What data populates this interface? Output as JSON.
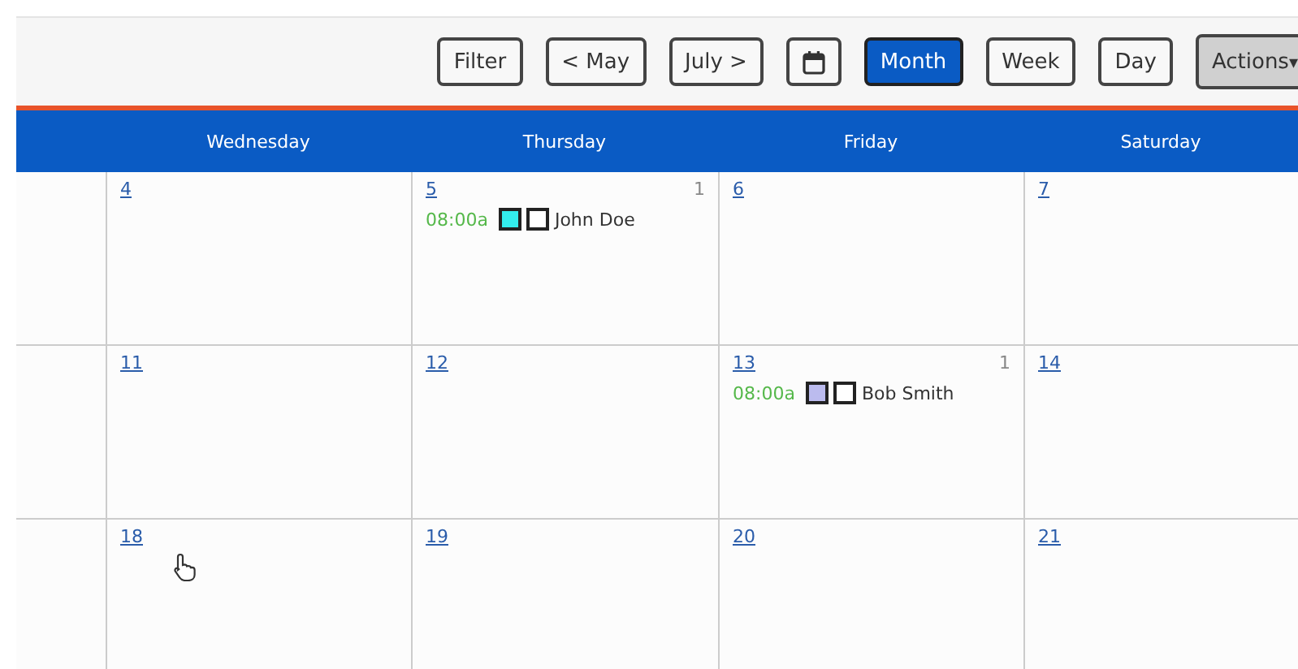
{
  "toolbar": {
    "buttons": [
      {
        "kind": "text",
        "label": "Filter",
        "selected": false
      },
      {
        "kind": "text",
        "label": "< May",
        "selected": false
      },
      {
        "kind": "text",
        "label": "July >",
        "selected": false
      },
      {
        "kind": "calendar",
        "selected": false
      },
      {
        "kind": "text",
        "label": "Month",
        "selected": true
      },
      {
        "kind": "text",
        "label": "Week",
        "selected": false
      },
      {
        "kind": "text",
        "label": "Day",
        "selected": false
      },
      {
        "kind": "menu",
        "label": "Actions",
        "caret": "▾",
        "selected": false
      }
    ]
  },
  "header": {
    "columns": [
      "Wednesday",
      "Thursday",
      "Friday",
      "Saturday"
    ]
  },
  "weeks": [
    {
      "days": [
        {
          "day": "4"
        },
        {
          "day": "5",
          "count": "1",
          "events": [
            {
              "time": "08:00a",
              "color": "#33eeee",
              "checked": false,
              "name": "John Doe"
            }
          ]
        },
        {
          "day": "6"
        },
        {
          "day": "7"
        }
      ]
    },
    {
      "days": [
        {
          "day": "11"
        },
        {
          "day": "12"
        },
        {
          "day": "13",
          "count": "1",
          "events": [
            {
              "time": "08:00a",
              "color": "#bbbbee",
              "checked": false,
              "name": "Bob Smith"
            }
          ]
        },
        {
          "day": "14"
        }
      ]
    },
    {
      "days": [
        {
          "day": "18",
          "cursor": true
        },
        {
          "day": "19"
        },
        {
          "day": "20"
        },
        {
          "day": "21"
        }
      ]
    }
  ]
}
